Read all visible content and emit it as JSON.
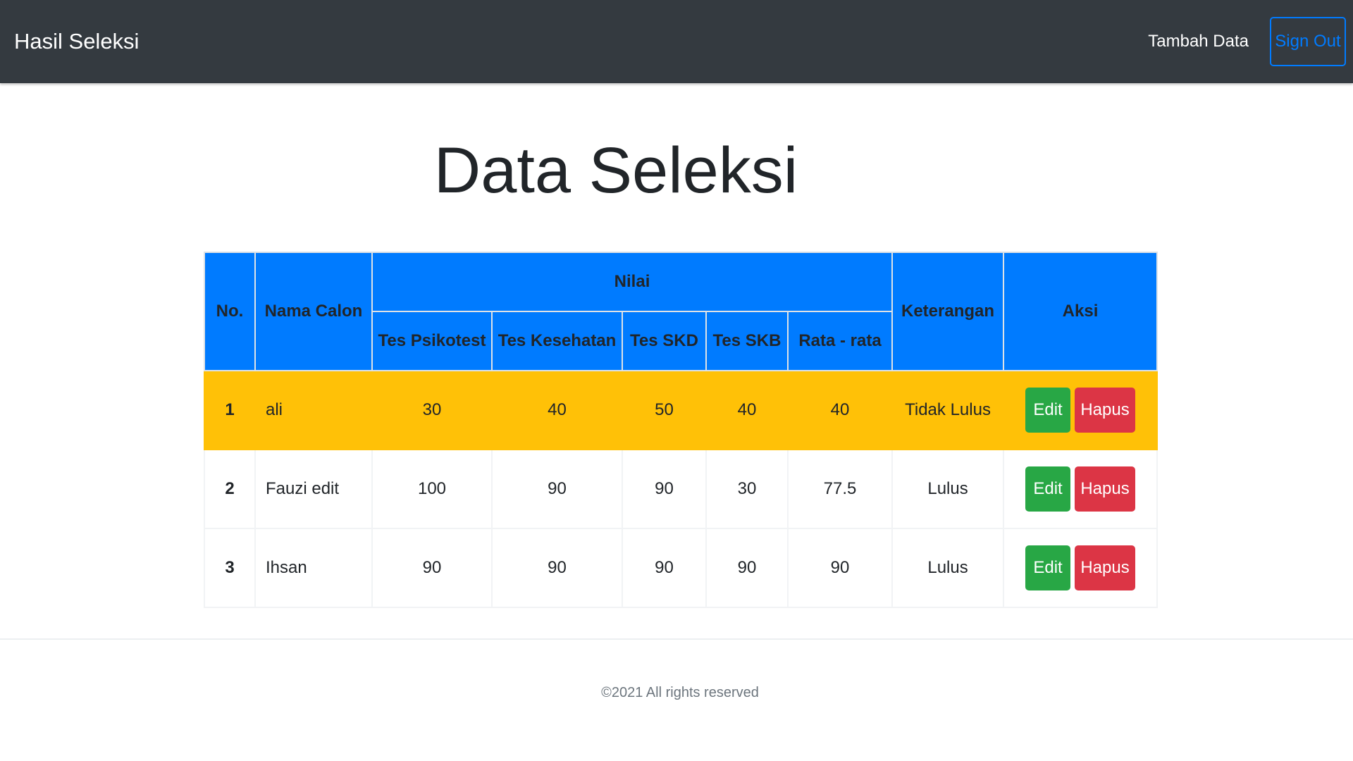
{
  "navbar": {
    "brand": "Hasil Seleksi",
    "tambah_label": "Tambah Data",
    "signout_label": "Sign Out"
  },
  "page": {
    "title": "Data Seleksi"
  },
  "table": {
    "headers": {
      "no": "No.",
      "nama": "Nama Calon",
      "nilai": "Nilai",
      "keterangan": "Keterangan",
      "aksi": "Aksi",
      "sub": [
        "Tes Psikotest",
        "Tes Kesehatan",
        "Tes SKD",
        "Tes SKB",
        "Rata - rata"
      ]
    },
    "rows": [
      {
        "no": "1",
        "nama": "ali",
        "psikotest": "30",
        "kesehatan": "40",
        "skd": "50",
        "skb": "40",
        "rata": "40",
        "keterangan": "Tidak Lulus",
        "edit": "Edit",
        "hapus": "Hapus"
      },
      {
        "no": "2",
        "nama": "Fauzi edit",
        "psikotest": "100",
        "kesehatan": "90",
        "skd": "90",
        "skb": "30",
        "rata": "77.5",
        "keterangan": "Lulus",
        "edit": "Edit",
        "hapus": "Hapus"
      },
      {
        "no": "3",
        "nama": "Ihsan",
        "psikotest": "90",
        "kesehatan": "90",
        "skd": "90",
        "skb": "90",
        "rata": "90",
        "keterangan": "Lulus",
        "edit": "Edit",
        "hapus": "Hapus"
      }
    ]
  },
  "footer": {
    "text": "©2021 All rights reserved"
  },
  "colors": {
    "navbar_bg": "#343a40",
    "header_bg": "#007bff",
    "highlight_row": "#ffc107",
    "edit_button": "#28a745",
    "hapus_button": "#dc3545"
  }
}
